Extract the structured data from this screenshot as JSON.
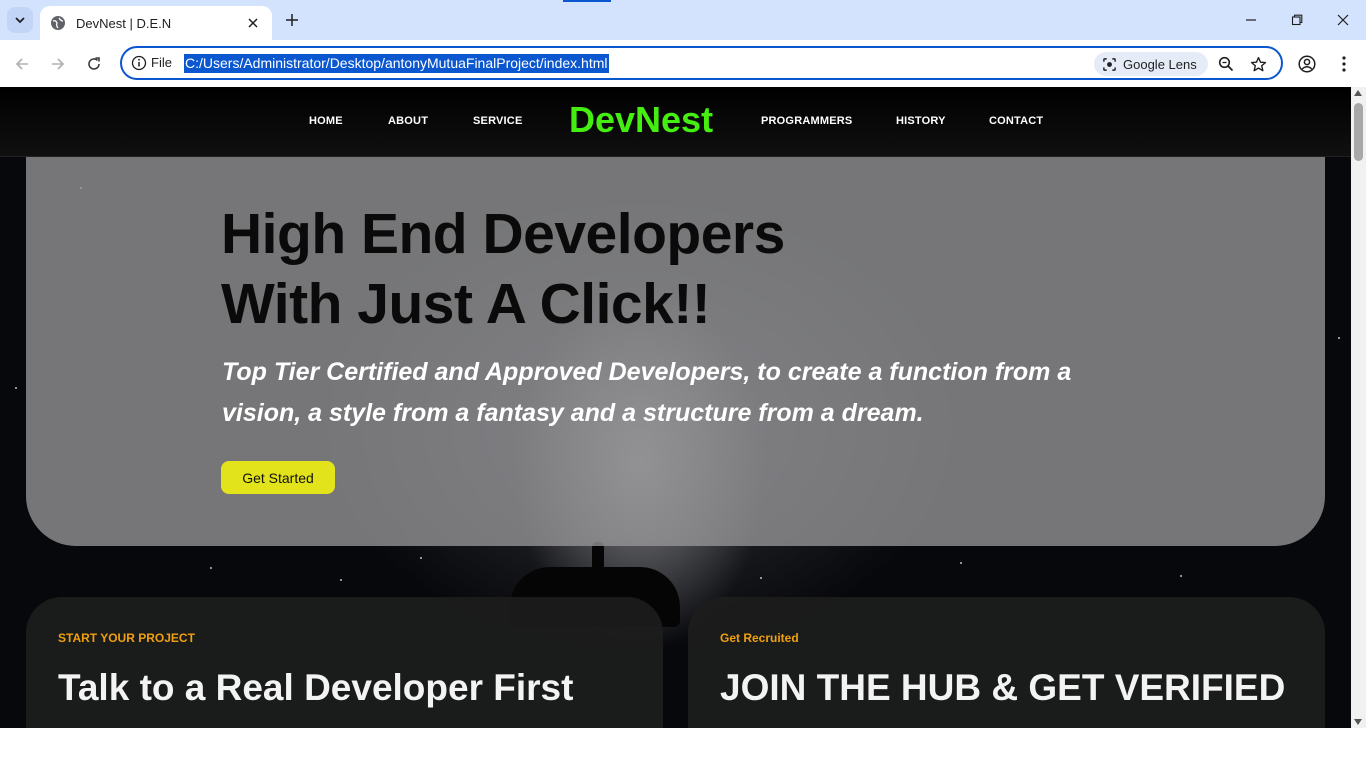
{
  "browser": {
    "tab_title": "DevNest | D.E.N",
    "omnibox_scheme": "File",
    "url": "C:/Users/Administrator/Desktop/antonyMutuaFinalProject/index.html",
    "lens_label": "Google Lens",
    "accent_color": "#0b57d0"
  },
  "nav": {
    "links_left": [
      "HOME",
      "ABOUT",
      "SERVICE"
    ],
    "brand": "DevNest",
    "links_right": [
      "PROGRAMMERS",
      "HISTORY",
      "CONTACT"
    ],
    "brand_color": "#44ee11"
  },
  "hero": {
    "title_line1": "High End Developers",
    "title_line2": "With Just A Click!!",
    "subtitle": "Top Tier Certified and Approved Developers, to create a function from a vision, a style from a fantasy and a structure from a dream.",
    "cta_label": "Get Started",
    "cta_color": "#e3e31b"
  },
  "cards": [
    {
      "eyebrow": "START YOUR PROJECT",
      "title": "Talk to a Real Developer First"
    },
    {
      "eyebrow": "Get Recruited",
      "title": "JOIN THE HUB & GET VERIFIED"
    }
  ],
  "icons": {
    "tab_search": "chevron-down-icon",
    "tab_favicon": "globe-icon",
    "tab_close": "close-icon",
    "new_tab": "plus-icon",
    "back": "arrow-left-icon",
    "forward": "arrow-right-icon",
    "reload": "reload-icon",
    "site_info": "info-icon",
    "lens": "lens-icon",
    "zoom": "zoom-icon",
    "bookmark": "star-icon",
    "profile": "profile-icon",
    "menu": "kebab-menu-icon"
  }
}
